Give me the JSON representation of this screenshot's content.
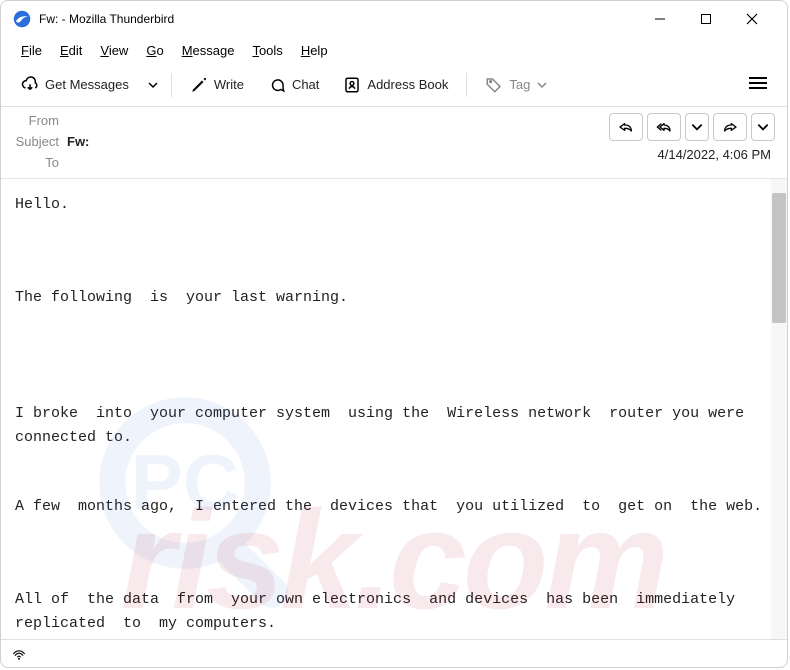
{
  "titlebar": {
    "title": "Fw: - Mozilla Thunderbird"
  },
  "menubar": {
    "file": "File",
    "edit": "Edit",
    "view": "View",
    "go": "Go",
    "message": "Message",
    "tools": "Tools",
    "help": "Help"
  },
  "toolbar": {
    "get_messages": "Get Messages",
    "write": "Write",
    "chat": "Chat",
    "address_book": "Address Book",
    "tag": "Tag"
  },
  "headers": {
    "from_label": "From",
    "from_value": "",
    "subject_label": "Subject",
    "subject_value": "Fw:",
    "to_label": "To",
    "to_value": "",
    "date": "4/14/2022, 4:06 PM"
  },
  "body": {
    "text": "Hello.\n\n\n\nThe following  is  your last warning.\n\n\n\n\nI broke  into  your computer system  using the  Wireless network  router you were connected to.\n\n\nA few  months ago,  I entered the  devices that  you utilized  to  get on  the web.\n\n\n\nAll of  the data  from  your own electronics  and devices  has been  immediately replicated  to  my computers."
  },
  "watermark": {
    "text": "risk.com"
  }
}
